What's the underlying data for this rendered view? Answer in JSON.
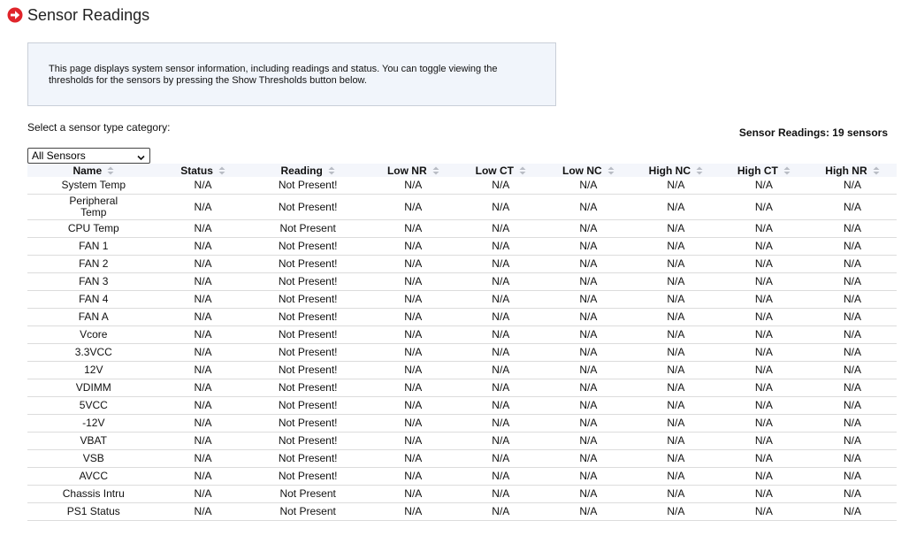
{
  "page": {
    "title": "Sensor Readings",
    "icon": "arrow-right-circle-icon",
    "accent_color": "#e0252b"
  },
  "info": {
    "text": "This page displays system sensor information, including readings and status. You can toggle viewing the thresholds for the sensors by pressing the Show Thresholds button below."
  },
  "filter": {
    "label": "Select a sensor type category:",
    "selected": "All Sensors"
  },
  "summary": {
    "count_text": "Sensor Readings: 19 sensors"
  },
  "table": {
    "columns": [
      "Name",
      "Status",
      "Reading",
      "Low NR",
      "Low CT",
      "Low NC",
      "High NC",
      "High CT",
      "High NR"
    ],
    "rows": [
      [
        "System Temp",
        "N/A",
        "Not Present!",
        "N/A",
        "N/A",
        "N/A",
        "N/A",
        "N/A",
        "N/A"
      ],
      [
        "Peripheral Temp",
        "N/A",
        "Not Present!",
        "N/A",
        "N/A",
        "N/A",
        "N/A",
        "N/A",
        "N/A"
      ],
      [
        "CPU Temp",
        "N/A",
        "Not Present",
        "N/A",
        "N/A",
        "N/A",
        "N/A",
        "N/A",
        "N/A"
      ],
      [
        "FAN 1",
        "N/A",
        "Not Present!",
        "N/A",
        "N/A",
        "N/A",
        "N/A",
        "N/A",
        "N/A"
      ],
      [
        "FAN 2",
        "N/A",
        "Not Present!",
        "N/A",
        "N/A",
        "N/A",
        "N/A",
        "N/A",
        "N/A"
      ],
      [
        "FAN 3",
        "N/A",
        "Not Present!",
        "N/A",
        "N/A",
        "N/A",
        "N/A",
        "N/A",
        "N/A"
      ],
      [
        "FAN 4",
        "N/A",
        "Not Present!",
        "N/A",
        "N/A",
        "N/A",
        "N/A",
        "N/A",
        "N/A"
      ],
      [
        "FAN A",
        "N/A",
        "Not Present!",
        "N/A",
        "N/A",
        "N/A",
        "N/A",
        "N/A",
        "N/A"
      ],
      [
        "Vcore",
        "N/A",
        "Not Present!",
        "N/A",
        "N/A",
        "N/A",
        "N/A",
        "N/A",
        "N/A"
      ],
      [
        "3.3VCC",
        "N/A",
        "Not Present!",
        "N/A",
        "N/A",
        "N/A",
        "N/A",
        "N/A",
        "N/A"
      ],
      [
        "12V",
        "N/A",
        "Not Present!",
        "N/A",
        "N/A",
        "N/A",
        "N/A",
        "N/A",
        "N/A"
      ],
      [
        "VDIMM",
        "N/A",
        "Not Present!",
        "N/A",
        "N/A",
        "N/A",
        "N/A",
        "N/A",
        "N/A"
      ],
      [
        "5VCC",
        "N/A",
        "Not Present!",
        "N/A",
        "N/A",
        "N/A",
        "N/A",
        "N/A",
        "N/A"
      ],
      [
        "-12V",
        "N/A",
        "Not Present!",
        "N/A",
        "N/A",
        "N/A",
        "N/A",
        "N/A",
        "N/A"
      ],
      [
        "VBAT",
        "N/A",
        "Not Present!",
        "N/A",
        "N/A",
        "N/A",
        "N/A",
        "N/A",
        "N/A"
      ],
      [
        "VSB",
        "N/A",
        "Not Present!",
        "N/A",
        "N/A",
        "N/A",
        "N/A",
        "N/A",
        "N/A"
      ],
      [
        "AVCC",
        "N/A",
        "Not Present!",
        "N/A",
        "N/A",
        "N/A",
        "N/A",
        "N/A",
        "N/A"
      ],
      [
        "Chassis Intru",
        "N/A",
        "Not Present",
        "N/A",
        "N/A",
        "N/A",
        "N/A",
        "N/A",
        "N/A"
      ],
      [
        "PS1 Status",
        "N/A",
        "Not Present",
        "N/A",
        "N/A",
        "N/A",
        "N/A",
        "N/A",
        "N/A"
      ]
    ]
  }
}
